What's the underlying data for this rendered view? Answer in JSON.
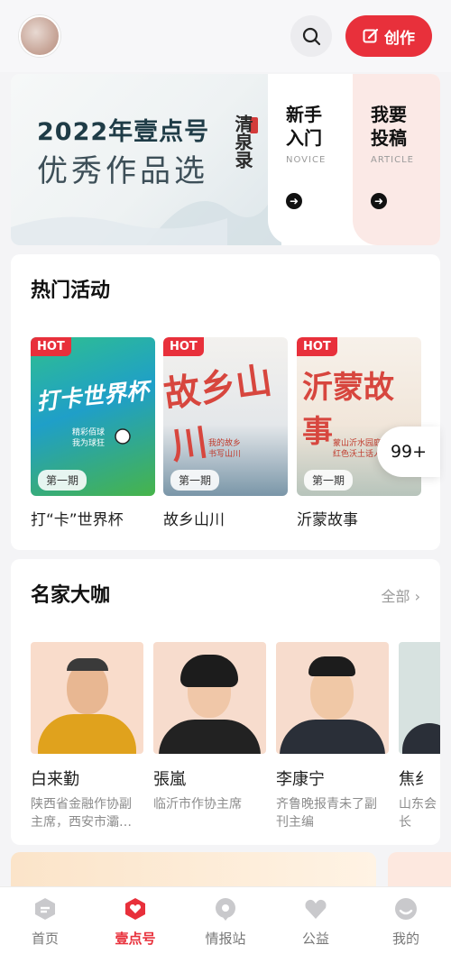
{
  "header": {
    "create_label": "创作"
  },
  "banner": {
    "title_line1": "2022年壹点号",
    "title_line2": "优秀作品选",
    "vertical_text": "清泉录",
    "cards": [
      {
        "title": "新手\n入门",
        "subtitle": "NOVICE"
      },
      {
        "title": "我要\n投稿",
        "subtitle": "ARTICLE"
      }
    ]
  },
  "activities": {
    "title": "热门活动",
    "badge": "HOT",
    "more_count": "99+",
    "items": [
      {
        "label": "打“卡”世界杯",
        "issue": "第一期",
        "art": "打卡世界杯",
        "caption": "精彩佰球\n我为球狂"
      },
      {
        "label": "故乡山川",
        "issue": "第一期",
        "art": "故乡山川",
        "caption": "我的故乡\n书写山川"
      },
      {
        "label": "沂蒙故事",
        "issue": "第一期",
        "art": "沂蒙故事",
        "caption": "蒙山沂水园庭\n红色沃土话人"
      }
    ]
  },
  "masters": {
    "title": "名家大咖",
    "all_label": "全部",
    "items": [
      {
        "name": "白来勤",
        "desc": "陕西省金融作协副主席，西安市灞…"
      },
      {
        "name": "張嵐",
        "desc": "临沂市作协主席"
      },
      {
        "name": "李康宁",
        "desc": "齐鲁晚报青未了副刊主编"
      },
      {
        "name": "焦纟",
        "desc": "山东会长"
      }
    ]
  },
  "nav": {
    "items": [
      {
        "label": "首页"
      },
      {
        "label": "壹点号"
      },
      {
        "label": "情报站"
      },
      {
        "label": "公益"
      },
      {
        "label": "我的"
      }
    ]
  }
}
